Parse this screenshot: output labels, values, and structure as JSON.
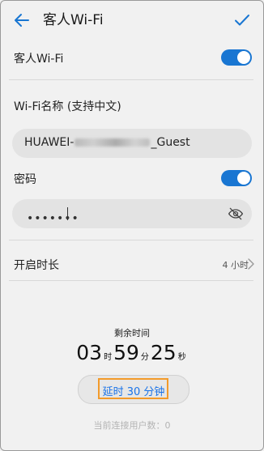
{
  "header": {
    "title": "客人Wi-Fi"
  },
  "guest_wifi": {
    "label": "客人Wi-Fi",
    "enabled": true
  },
  "ssid": {
    "label": "Wi-Fi名称 (支持中文)",
    "prefix": "HUAWEI-",
    "suffix": "_Guest"
  },
  "password": {
    "label": "密码",
    "enabled": true,
    "masked_value": "•••••••"
  },
  "duration": {
    "label": "开启时长",
    "value": "4 小时"
  },
  "remaining": {
    "label": "剩余时间",
    "hours": "03",
    "hours_unit": "时",
    "minutes": "59",
    "minutes_unit": "分",
    "seconds": "25",
    "seconds_unit": "秒"
  },
  "extend_button": {
    "label": "延时 30 分钟"
  },
  "connected_users": {
    "text": "当前连接用户数：0"
  },
  "colors": {
    "accent": "#1976d2",
    "focus_outline": "#f39a2a",
    "link": "#1a73e8"
  },
  "icons": [
    "back-arrow-icon",
    "check-icon",
    "eye-off-icon",
    "chevron-right-icon"
  ]
}
